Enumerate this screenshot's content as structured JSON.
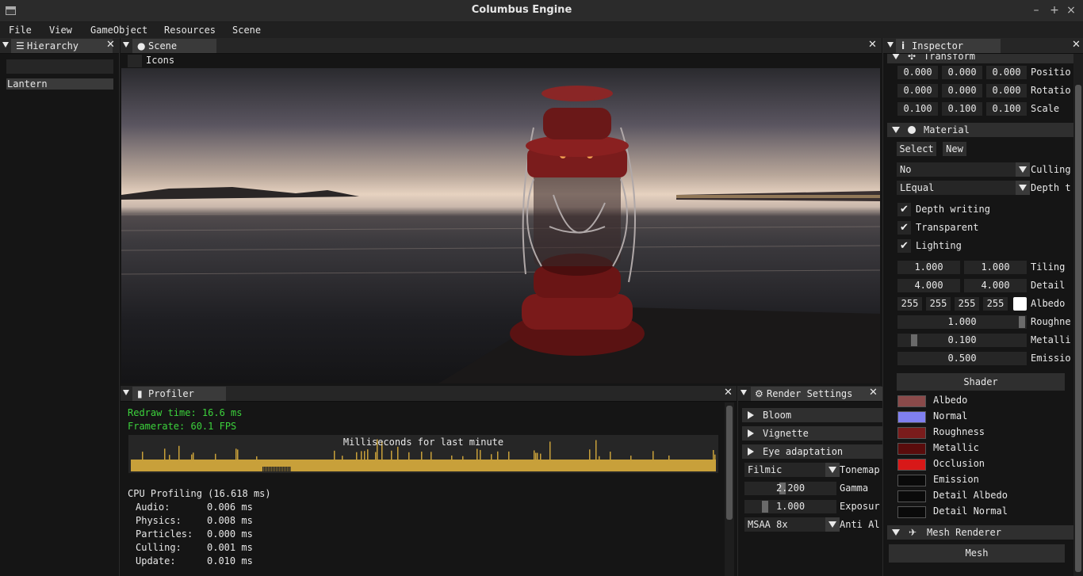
{
  "window": {
    "title": "Columbus Engine",
    "buttons": [
      "–",
      "+",
      "×"
    ]
  },
  "menu": [
    "File",
    "View",
    "GameObject",
    "Resources",
    "Scene"
  ],
  "hierarchy": {
    "tab": "Hierarchy",
    "search_value": "",
    "items": [
      "Lantern"
    ]
  },
  "scene": {
    "tab": "Scene",
    "icons_label": "Icons"
  },
  "profiler": {
    "tab": "Profiler",
    "redraw": "Redraw time: 16.6 ms",
    "framerate": "Framerate:   60.1 FPS",
    "graph_title": "Milliseconds for last minute",
    "cpu_title": "CPU Profiling (16.618 ms)",
    "rows": [
      {
        "name": "Audio:",
        "value": "0.006 ms"
      },
      {
        "name": "Physics:",
        "value": "0.008 ms"
      },
      {
        "name": "Particles:",
        "value": "0.000 ms"
      },
      {
        "name": "Culling:",
        "value": "0.001 ms"
      },
      {
        "name": "Update:",
        "value": "0.010 ms"
      }
    ],
    "colors": {
      "text_green": "#3cd23c",
      "graph_bar": "#c8a03a"
    }
  },
  "render_settings": {
    "tab": "Render Settings",
    "sections": [
      "Bloom",
      "Vignette",
      "Eye adaptation"
    ],
    "tonemap_value": "Filmic",
    "tonemap_label": "Tonemap",
    "gamma_value": "2.200",
    "gamma_label": "Gamma",
    "exposure_value": "1.000",
    "exposure_label": "Exposur",
    "aa_value": "MSAA 8x",
    "aa_label": "Anti Al"
  },
  "inspector": {
    "tab": "Inspector",
    "transform": {
      "header": "Transform",
      "rows": [
        {
          "values": [
            "0.000",
            "0.000",
            "0.000"
          ],
          "label": "Positio"
        },
        {
          "values": [
            "0.000",
            "0.000",
            "0.000"
          ],
          "label": "Rotatio"
        },
        {
          "values": [
            "0.100",
            "0.100",
            "0.100"
          ],
          "label": "Scale"
        }
      ]
    },
    "material": {
      "header": "Material",
      "select_label": "Select",
      "new_label": "New",
      "culling_value": "No",
      "culling_label": "Culling",
      "depth_value": "LEqual",
      "depth_label": "Depth t",
      "checks": [
        "Depth writing",
        "Transparent",
        "Lighting"
      ],
      "tiling": [
        "1.000",
        "1.000"
      ],
      "tiling_label": "Tiling",
      "detail": [
        "4.000",
        "4.000"
      ],
      "detail_label": "Detail",
      "albedo": [
        "255",
        "255",
        "255",
        "255"
      ],
      "albedo_label": "Albedo",
      "roughness_value": "1.000",
      "roughness_label": "Roughne",
      "roughness_level": 1.0,
      "metallic_value": "0.100",
      "metallic_label": "Metalli",
      "metallic_level": 0.1,
      "emission_value": "0.500",
      "emission_label": "Emissio",
      "shader_label": "Shader",
      "textures": [
        {
          "label": "Albedo",
          "color": "#8a4a4a"
        },
        {
          "label": "Normal",
          "color": "#8080f0"
        },
        {
          "label": "Roughness",
          "color": "#7a1c1c"
        },
        {
          "label": "Metallic",
          "color": "#5a0c0c"
        },
        {
          "label": "Occlusion",
          "color": "#d81818"
        },
        {
          "label": "Emission",
          "color": "#0a0a0a"
        },
        {
          "label": "Detail Albedo",
          "color": "#0a0a0a"
        },
        {
          "label": "Detail Normal",
          "color": "#0a0a0a"
        }
      ]
    },
    "mesh_renderer": {
      "header": "Mesh Renderer",
      "mesh_label": "Mesh"
    }
  }
}
